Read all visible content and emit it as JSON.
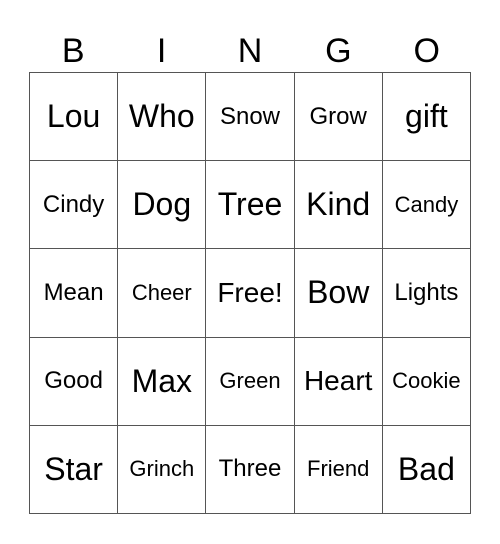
{
  "header": {
    "letters": [
      "B",
      "I",
      "N",
      "G",
      "O"
    ]
  },
  "card": {
    "rows": [
      [
        "Lou",
        "Who",
        "Snow",
        "Grow",
        "gift"
      ],
      [
        "Cindy",
        "Dog",
        "Tree",
        "Kind",
        "Candy"
      ],
      [
        "Mean",
        "Cheer",
        "Free!",
        "Bow",
        "Lights"
      ],
      [
        "Good",
        "Max",
        "Green",
        "Heart",
        "Cookie"
      ],
      [
        "Star",
        "Grinch",
        "Three",
        "Friend",
        "Bad"
      ]
    ]
  }
}
